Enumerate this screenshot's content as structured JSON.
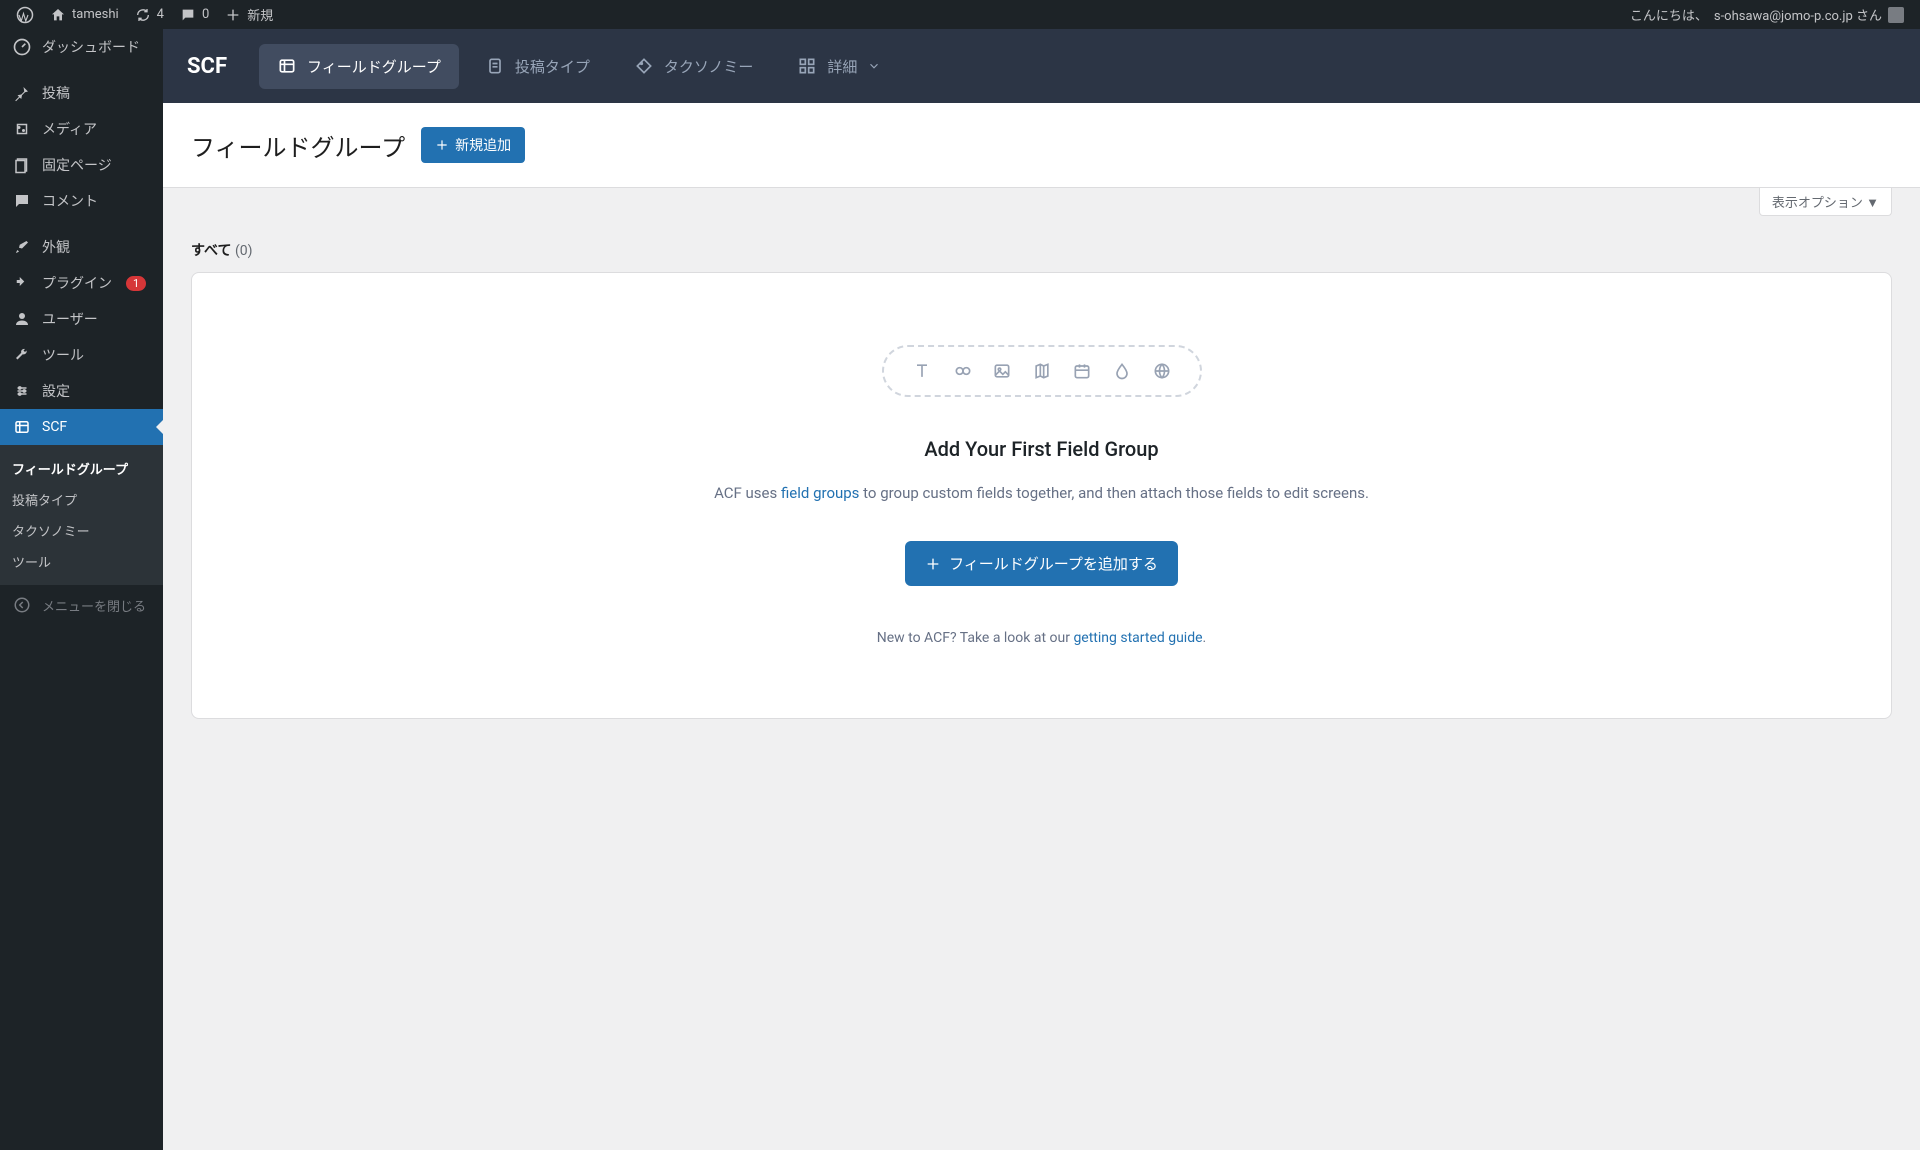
{
  "adminBar": {
    "siteName": "tameshi",
    "updateCount": "4",
    "commentCount": "0",
    "newLabel": "新規",
    "greeting": "こんにちは、",
    "userName": "s-ohsawa@jomo-p.co.jp さん"
  },
  "sidebar": {
    "items": [
      {
        "label": "ダッシュボード"
      },
      {
        "label": "投稿"
      },
      {
        "label": "メディア"
      },
      {
        "label": "固定ページ"
      },
      {
        "label": "コメント"
      },
      {
        "label": "外観"
      },
      {
        "label": "プラグイン",
        "badge": "1"
      },
      {
        "label": "ユーザー"
      },
      {
        "label": "ツール"
      },
      {
        "label": "設定"
      },
      {
        "label": "SCF"
      }
    ],
    "submenu": [
      {
        "label": "フィールドグループ",
        "active": true
      },
      {
        "label": "投稿タイプ"
      },
      {
        "label": "タクソノミー"
      },
      {
        "label": "ツール"
      }
    ],
    "collapse": "メニューを閉じる"
  },
  "scfNav": {
    "logo": "SCF",
    "tabs": [
      {
        "label": "フィールドグループ",
        "active": true
      },
      {
        "label": "投稿タイプ"
      },
      {
        "label": "タクソノミー"
      },
      {
        "label": "詳細"
      }
    ]
  },
  "page": {
    "title": "フィールドグループ",
    "addNew": "新規追加",
    "screenOptions": "表示オプション",
    "filterLabel": "すべて",
    "filterCount": "(0)"
  },
  "empty": {
    "title": "Add Your First Field Group",
    "descPrefix": "ACF uses ",
    "descLink": "field groups",
    "descSuffix": " to group custom fields together, and then attach those fields to edit screens.",
    "button": "フィールドグループを追加する",
    "footerPrefix": "New to ACF? Take a look at our ",
    "footerLink": "getting started guide",
    "footerSuffix": "."
  }
}
